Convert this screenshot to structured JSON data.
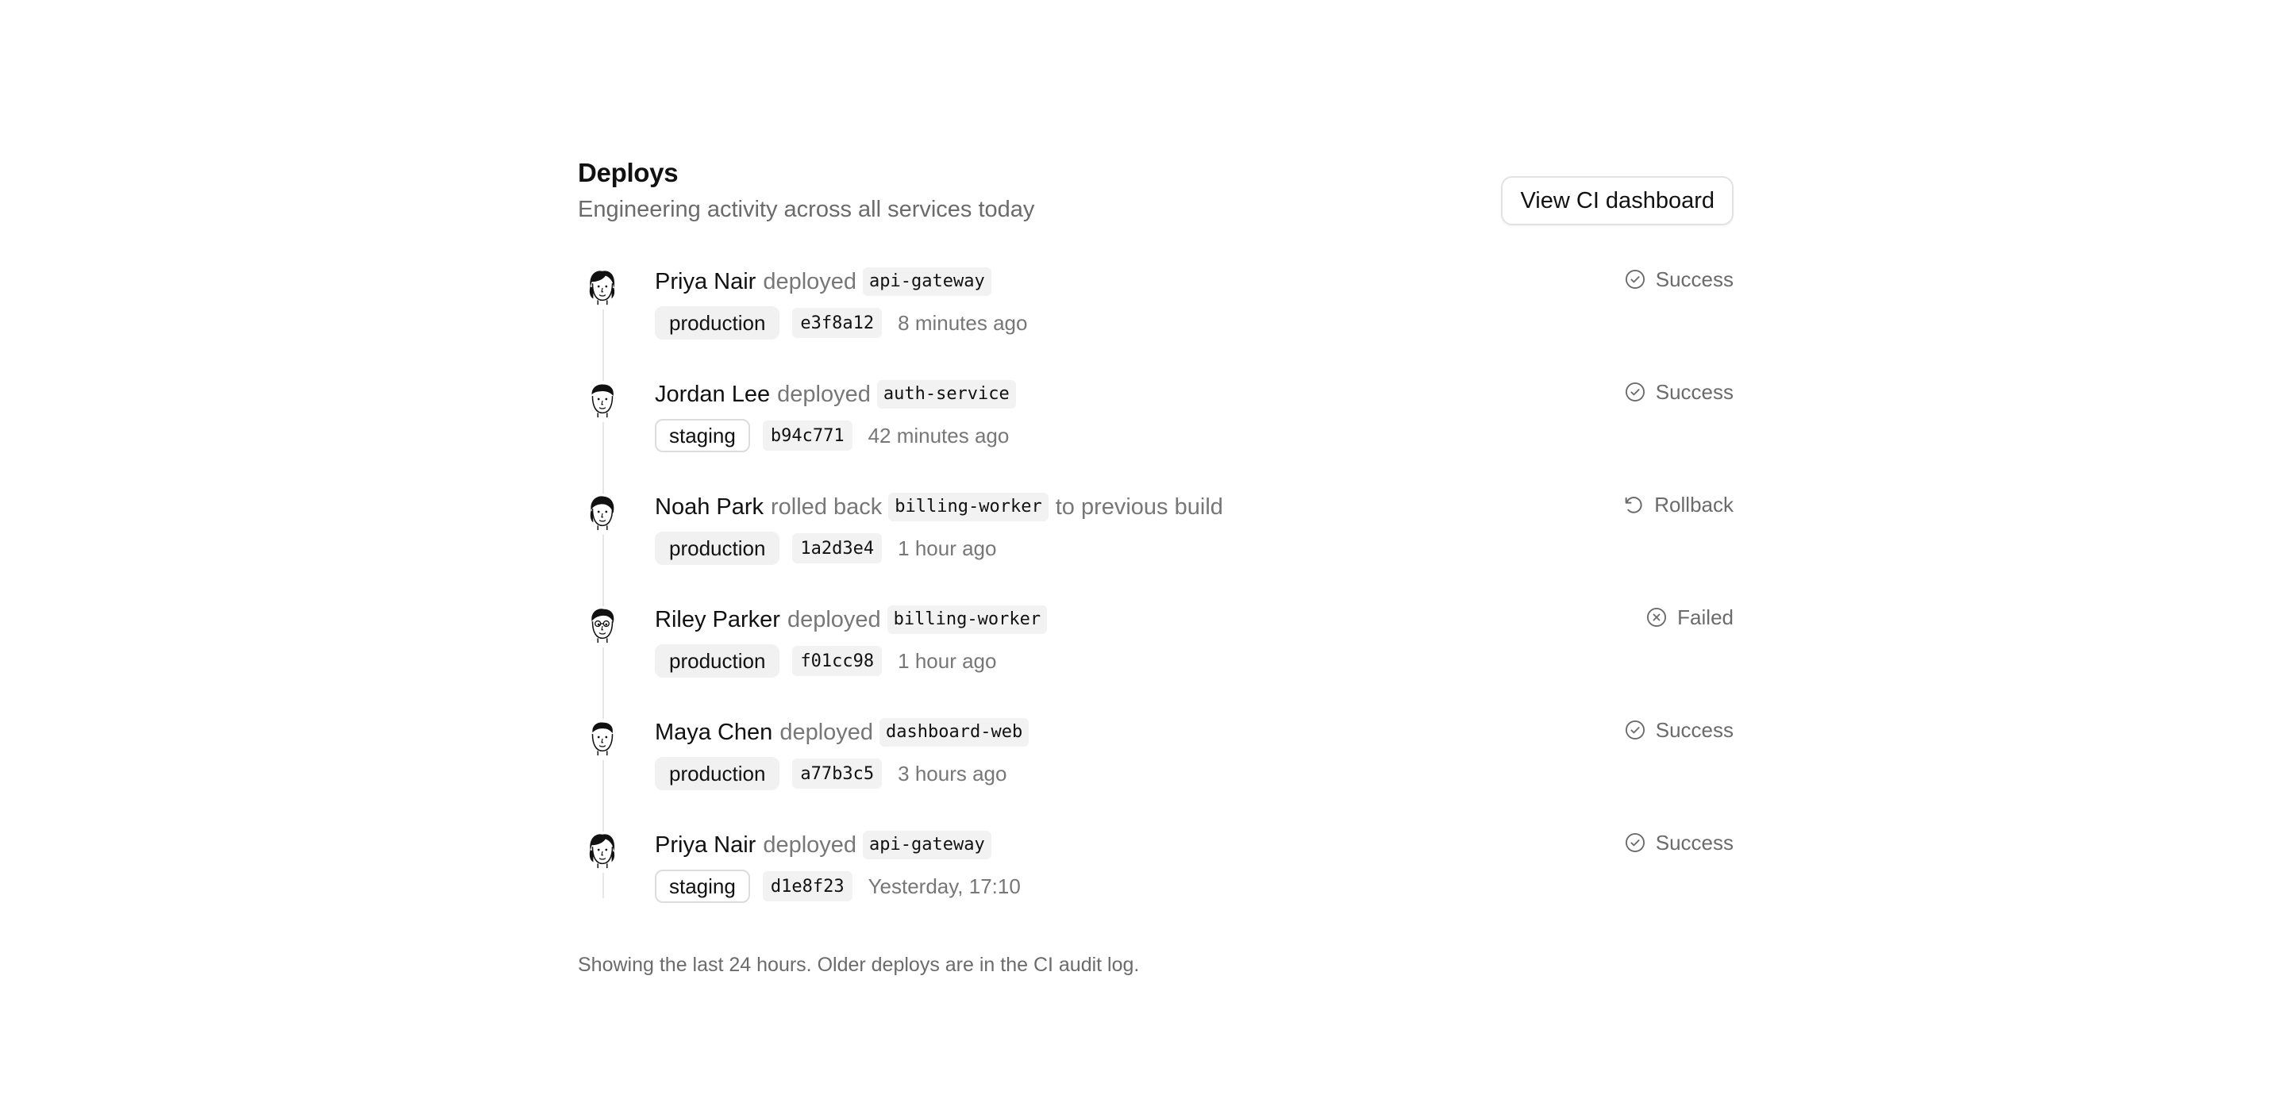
{
  "header": {
    "title": "Deploys",
    "subtitle": "Engineering activity across all services today",
    "ci_button_label": "View CI dashboard"
  },
  "deploys": [
    {
      "actor": "Priya Nair",
      "verb": "deployed",
      "service": "api-gateway",
      "suffix": "",
      "environment": "production",
      "commit": "e3f8a12",
      "time": "8 minutes ago",
      "status": "Success",
      "status_icon": "check-circle-icon",
      "avatar": "avatar-priya-nair"
    },
    {
      "actor": "Jordan Lee",
      "verb": "deployed",
      "service": "auth-service",
      "suffix": "",
      "environment": "staging",
      "commit": "b94c771",
      "time": "42 minutes ago",
      "status": "Success",
      "status_icon": "check-circle-icon",
      "avatar": "avatar-jordan-lee"
    },
    {
      "actor": "Noah Park",
      "verb": "rolled back",
      "service": "billing-worker",
      "suffix": "to previous build",
      "environment": "production",
      "commit": "1a2d3e4",
      "time": "1 hour ago",
      "status": "Rollback",
      "status_icon": "rollback-icon",
      "avatar": "avatar-noah-park"
    },
    {
      "actor": "Riley Parker",
      "verb": "deployed",
      "service": "billing-worker",
      "suffix": "",
      "environment": "production",
      "commit": "f01cc98",
      "time": "1 hour ago",
      "status": "Failed",
      "status_icon": "x-circle-icon",
      "avatar": "avatar-riley-parker"
    },
    {
      "actor": "Maya Chen",
      "verb": "deployed",
      "service": "dashboard-web",
      "suffix": "",
      "environment": "production",
      "commit": "a77b3c5",
      "time": "3 hours ago",
      "status": "Success",
      "status_icon": "check-circle-icon",
      "avatar": "avatar-maya-chen"
    },
    {
      "actor": "Priya Nair",
      "verb": "deployed",
      "service": "api-gateway",
      "suffix": "",
      "environment": "staging",
      "commit": "d1e8f23",
      "time": "Yesterday, 17:10",
      "status": "Success",
      "status_icon": "check-circle-icon",
      "avatar": "avatar-priya-nair"
    }
  ],
  "footer": {
    "note": "Showing the last 24 hours. Older deploys are in the CI audit log."
  },
  "colors": {
    "text": "#111111",
    "muted": "#6b6b6b",
    "chip_bg": "#f2f2f2",
    "border": "#e2e2e2",
    "rail": "#e6e6e6"
  }
}
